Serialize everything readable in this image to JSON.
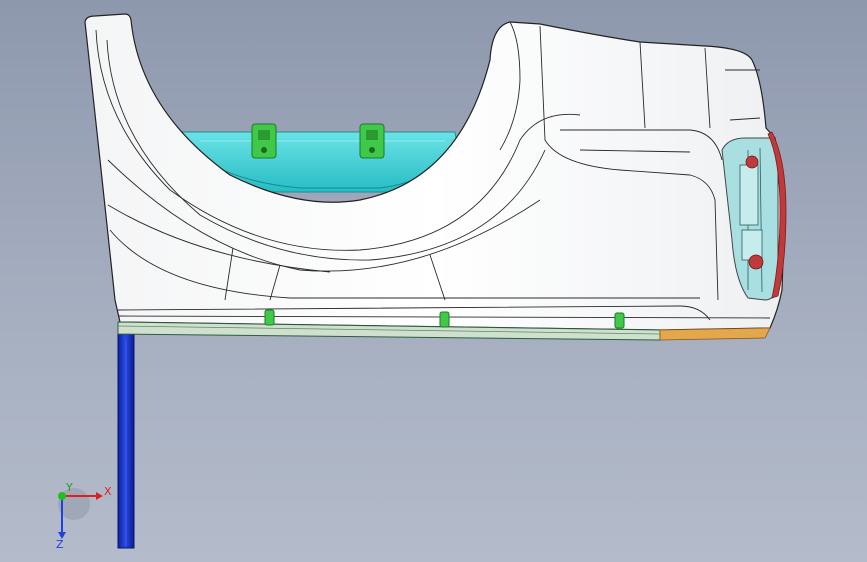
{
  "viewport": {
    "background_top": "#8e98ad",
    "background_bottom": "#b4bccb"
  },
  "model": {
    "panel_color": "#ffffff",
    "inner_cavity_color": "#3fd3d8",
    "clip_color": "#34c23c",
    "support_column_color": "#1e3ad8",
    "lamp_housing_color": "#a9dfe0",
    "lamp_rim_color": "#c0393b",
    "bottom_trim_color": "#e3a84e"
  },
  "triad": {
    "x_label": "X",
    "y_label": "Y",
    "z_label": "Z",
    "x_color": "#e02020",
    "y_color": "#20c020",
    "z_color": "#2040e0"
  }
}
